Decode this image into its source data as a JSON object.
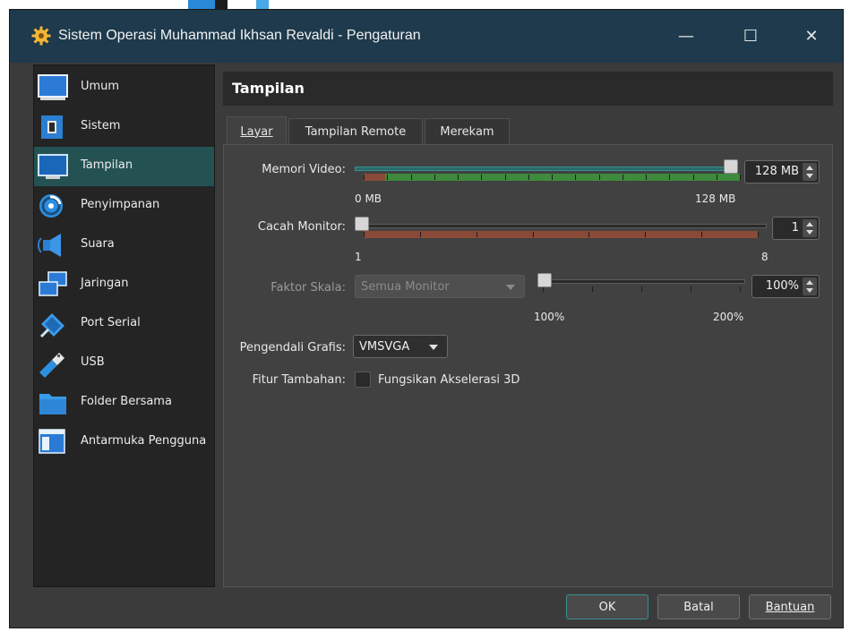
{
  "window": {
    "title": "Sistem Operasi Muhammad Ikhsan Revaldi - Pengaturan",
    "controls": {
      "minimize": "—",
      "maximize": "☐",
      "close": "✕"
    }
  },
  "sidebar": {
    "items": [
      {
        "label": "Umum",
        "icon": "monitor-general-icon",
        "active": false
      },
      {
        "label": "Sistem",
        "icon": "chip-icon",
        "active": false
      },
      {
        "label": "Tampilan",
        "icon": "display-icon",
        "active": true
      },
      {
        "label": "Penyimpanan",
        "icon": "storage-disc-icon",
        "active": false
      },
      {
        "label": "Suara",
        "icon": "speaker-icon",
        "active": false
      },
      {
        "label": "Jaringan",
        "icon": "network-icon",
        "active": false
      },
      {
        "label": "Port Serial",
        "icon": "serial-port-icon",
        "active": false
      },
      {
        "label": "USB",
        "icon": "usb-icon",
        "active": false
      },
      {
        "label": "Folder Bersama",
        "icon": "folder-icon",
        "active": false
      },
      {
        "label": "Antarmuka Pengguna",
        "icon": "user-interface-icon",
        "active": false
      }
    ]
  },
  "section": {
    "title": "Tampilan"
  },
  "tabs": [
    {
      "label": "Layar",
      "active": true
    },
    {
      "label": "Tampilan Remote",
      "active": false
    },
    {
      "label": "Merekam",
      "active": false
    }
  ],
  "screen": {
    "video_memory": {
      "label": "Memori Video:",
      "value": "128 MB",
      "min": "0 MB",
      "max": "128 MB",
      "level": 1.0
    },
    "monitor_count": {
      "label": "Cacah Monitor:",
      "value": "1",
      "min": "1",
      "max": "8",
      "level": 0.0
    },
    "scale_factor": {
      "label": "Faktor Skala:",
      "combo": "Semua Monitor",
      "value": "100%",
      "min": "100%",
      "max": "200%",
      "level": 0.0
    },
    "graphics_controller": {
      "label": "Pengendali Grafis:",
      "value": "VMSVGA"
    },
    "extra_features": {
      "label": "Fitur Tambahan:",
      "checkbox_label": "Fungsikan Akselerasi 3D",
      "checked": false
    }
  },
  "buttons": {
    "ok": "OK",
    "cancel": "Batal",
    "help": "Bantuan"
  },
  "colors": {
    "titlebar": "#1e3a4c",
    "accent": "#245253",
    "green_range": "#3f8a3c",
    "red_range": "#8a4a37"
  }
}
